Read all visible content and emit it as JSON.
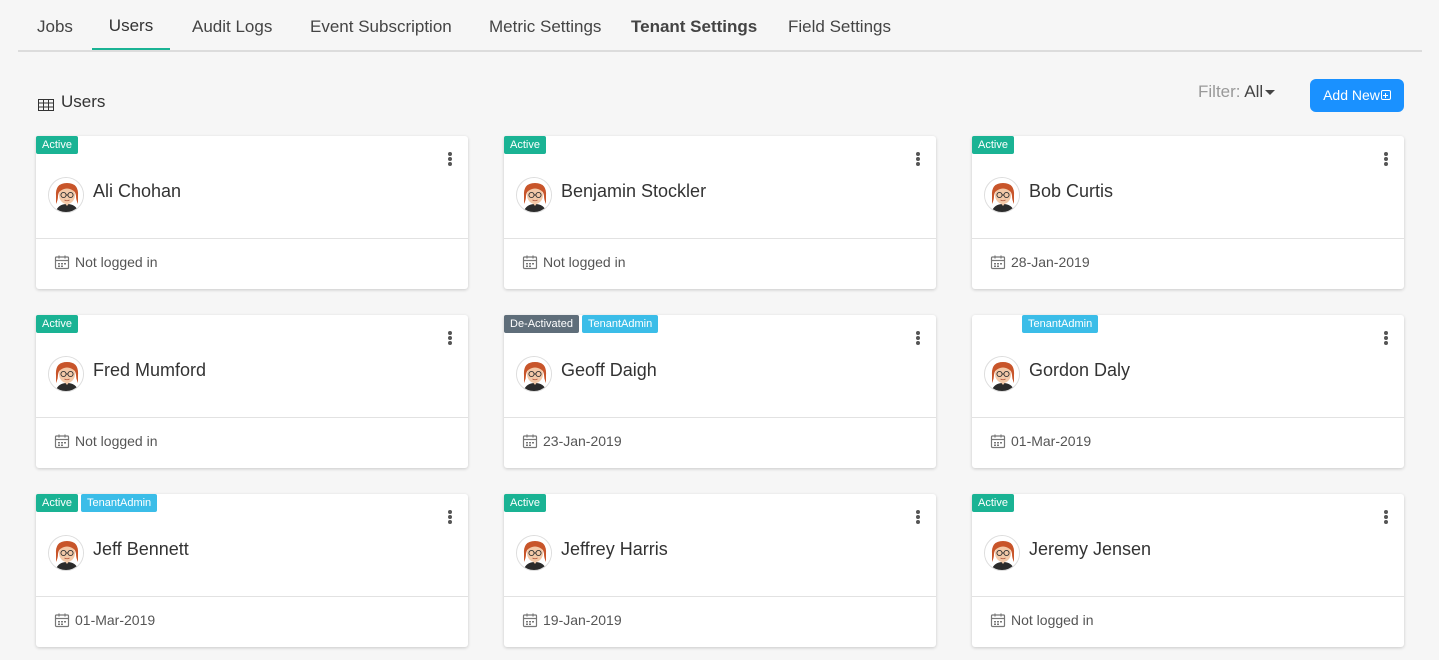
{
  "tabs": [
    {
      "label": "Jobs"
    },
    {
      "label": "Users"
    },
    {
      "label": "Audit Logs"
    },
    {
      "label": "Event Subscription"
    },
    {
      "label": "Metric Settings"
    },
    {
      "label": "Tenant Settings"
    },
    {
      "label": "Field Settings"
    }
  ],
  "section": {
    "title": "Users",
    "icon": "table-grid-icon"
  },
  "filter": {
    "label": "Filter:",
    "value": "All"
  },
  "add_button": {
    "label": "Add New"
  },
  "colors": {
    "accent": "#1ab394",
    "primary_button": "#1a91ff",
    "badge_active": "#1ab394",
    "badge_deactivated": "#5f6e7a",
    "badge_tenant_admin": "#3bbde8"
  },
  "users": [
    {
      "name": "Ali Chohan",
      "badges": [
        {
          "label": "Active",
          "type": "active"
        }
      ],
      "last_login": "Not logged in"
    },
    {
      "name": "Benjamin Stockler",
      "badges": [
        {
          "label": "Active",
          "type": "active"
        }
      ],
      "last_login": "Not logged in"
    },
    {
      "name": "Bob Curtis",
      "badges": [
        {
          "label": "Active",
          "type": "active"
        }
      ],
      "last_login": "28-Jan-2019"
    },
    {
      "name": "Fred Mumford",
      "badges": [
        {
          "label": "Active",
          "type": "active"
        }
      ],
      "last_login": "Not logged in"
    },
    {
      "name": "Geoff Daigh",
      "badges": [
        {
          "label": "De-Activated",
          "type": "deact"
        },
        {
          "label": "TenantAdmin",
          "type": "tenant"
        }
      ],
      "last_login": "23-Jan-2019"
    },
    {
      "name": "Gordon Daly",
      "badges": [
        {
          "label": "TenantAdmin",
          "type": "tenant"
        }
      ],
      "last_login": "01-Mar-2019"
    },
    {
      "name": "Jeff Bennett",
      "badges": [
        {
          "label": "Active",
          "type": "active"
        },
        {
          "label": "TenantAdmin",
          "type": "tenant"
        }
      ],
      "last_login": "01-Mar-2019"
    },
    {
      "name": "Jeffrey Harris",
      "badges": [
        {
          "label": "Active",
          "type": "active"
        }
      ],
      "last_login": "19-Jan-2019"
    },
    {
      "name": "Jeremy Jensen",
      "badges": [
        {
          "label": "Active",
          "type": "active"
        }
      ],
      "last_login": "Not logged in"
    }
  ]
}
